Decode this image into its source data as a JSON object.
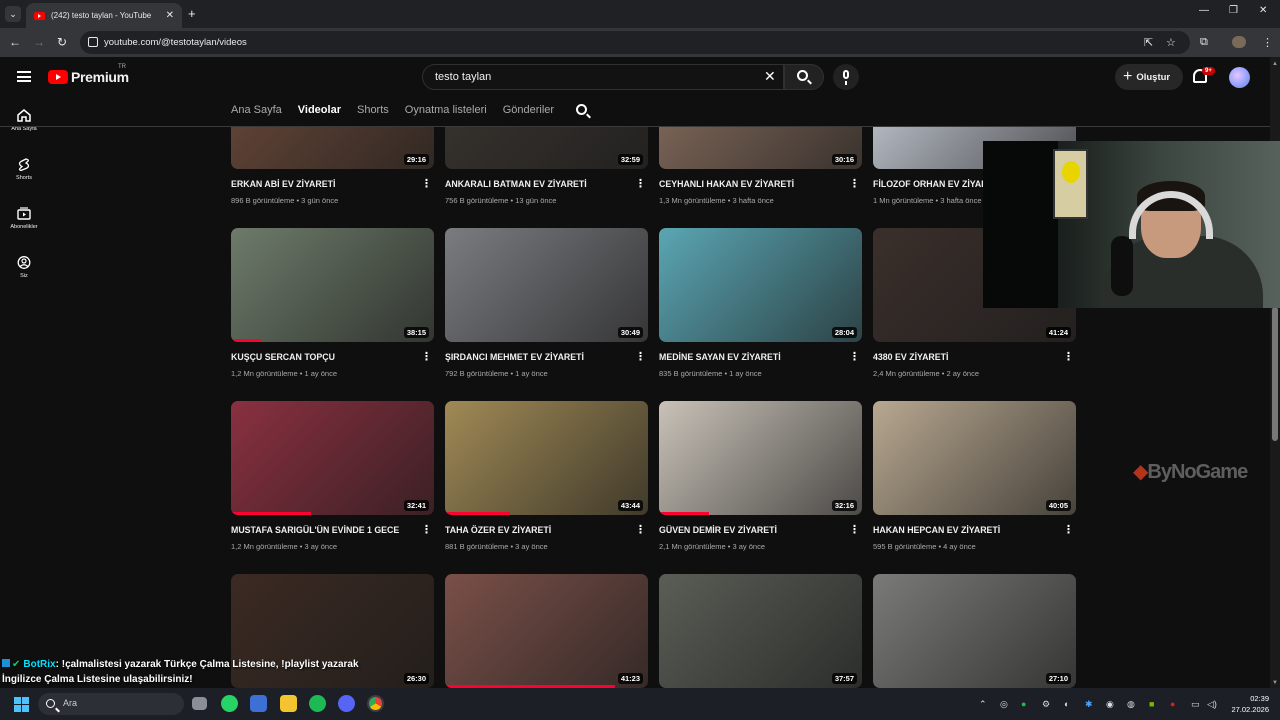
{
  "browser": {
    "tab_title": "(242) testo taylan - YouTube",
    "tab_close": "✕",
    "new_tab": "+",
    "url": "youtube.com/@testotaylan/videos",
    "win_minimize": "—",
    "win_restore": "❐",
    "win_close": "✕"
  },
  "header": {
    "logo_text": "Premium",
    "region": "TR",
    "search_value": "testo taylan",
    "clear_label": "✕",
    "create_label": "Oluştur",
    "notifications_badge": "9+"
  },
  "sidebar": {
    "items": [
      {
        "label": "Ana Sayfa",
        "icon": "home-icon"
      },
      {
        "label": "Shorts",
        "icon": "shorts-icon"
      },
      {
        "label": "Abonelikler",
        "icon": "subscriptions-icon"
      },
      {
        "label": "Siz",
        "icon": "you-icon"
      }
    ]
  },
  "channel_tabs": [
    "Ana Sayfa",
    "Videolar",
    "Shorts",
    "Oynatma listeleri",
    "Gönderiler"
  ],
  "active_tab": "Videolar",
  "videos": [
    {
      "title": "ERKAN ABİ EV ZİYARETİ",
      "meta": "896 B görüntüleme • 3 gün önce",
      "duration": "29:16",
      "color": "#6b4a3a"
    },
    {
      "title": "ANKARALI BATMAN EV ZİYARETİ",
      "meta": "756 B görüntüleme • 13 gün önce",
      "duration": "32:59",
      "color": "#3a3530"
    },
    {
      "title": "CEYHANLI HAKAN EV ZİYARETİ",
      "meta": "1,3 Mn görüntüleme • 3 hafta önce",
      "duration": "30:16",
      "color": "#8a7060"
    },
    {
      "title": "FİLOZOF ORHAN EV ZİYARETİ",
      "meta": "1 Mn görüntüleme • 3 hafta önce",
      "duration": "",
      "color": "#cfd5df"
    },
    {
      "title": "KUŞÇU SERCAN TOPÇU",
      "meta": "1,2 Mn görüntüleme • 1 ay önce",
      "duration": "38:15",
      "color": "#6d7b6a"
    },
    {
      "title": "ŞIRDANCI MEHMET EV ZİYARETİ",
      "meta": "792 B görüntüleme • 1 ay önce",
      "duration": "30:49",
      "color": "#7b7c80"
    },
    {
      "title": "MEDİNE SAYAN EV ZİYARETİ",
      "meta": "835 B görüntüleme • 1 ay önce",
      "duration": "28:04",
      "color": "#5aa6b3"
    },
    {
      "title": "4380 EV ZİYARETİ",
      "meta": "2,4 Mn görüntüleme • 2 ay önce",
      "duration": "41:24",
      "color": "#3a2f2b"
    },
    {
      "title": "MUSTAFA SARIGÜL'ÜN EVİNDE 1 GECE",
      "meta": "1,2 Mn görüntüleme • 3 ay önce",
      "duration": "32:41",
      "color": "#8a3040"
    },
    {
      "title": "TAHA ÖZER EV ZİYARETİ",
      "meta": "881 B görüntüleme • 3 ay önce",
      "duration": "43:44",
      "color": "#a08a55"
    },
    {
      "title": "GÜVEN DEMİR EV ZİYARETİ",
      "meta": "2,1 Mn görüntüleme • 3 ay önce",
      "duration": "32:16",
      "color": "#c9c2b8"
    },
    {
      "title": "HAKAN HEPCAN EV ZİYARETİ",
      "meta": "595 B görüntüleme • 4 ay önce",
      "duration": "40:05",
      "color": "#b8a890"
    },
    {
      "title": "",
      "meta": "",
      "duration": "26:30",
      "color": "#3b2a22"
    },
    {
      "title": "",
      "meta": "",
      "duration": "41:23",
      "color": "#7a5048"
    },
    {
      "title": "",
      "meta": "",
      "duration": "37:57",
      "color": "#5a5e56"
    },
    {
      "title": "",
      "meta": "",
      "duration": "27:10",
      "color": "#7a7a78"
    }
  ],
  "overlay": {
    "watermark": "ByNoGame",
    "chat_user": "BotRix",
    "chat_message": ": !çalmalistesi yazarak Türkçe Çalma Listesine, !playlist yazarak İngilizce Çalma Listesine ulaşabilirsiniz!"
  },
  "taskbar": {
    "search_placeholder": "Ara",
    "time": "02:39",
    "date": "27.02.2026"
  }
}
